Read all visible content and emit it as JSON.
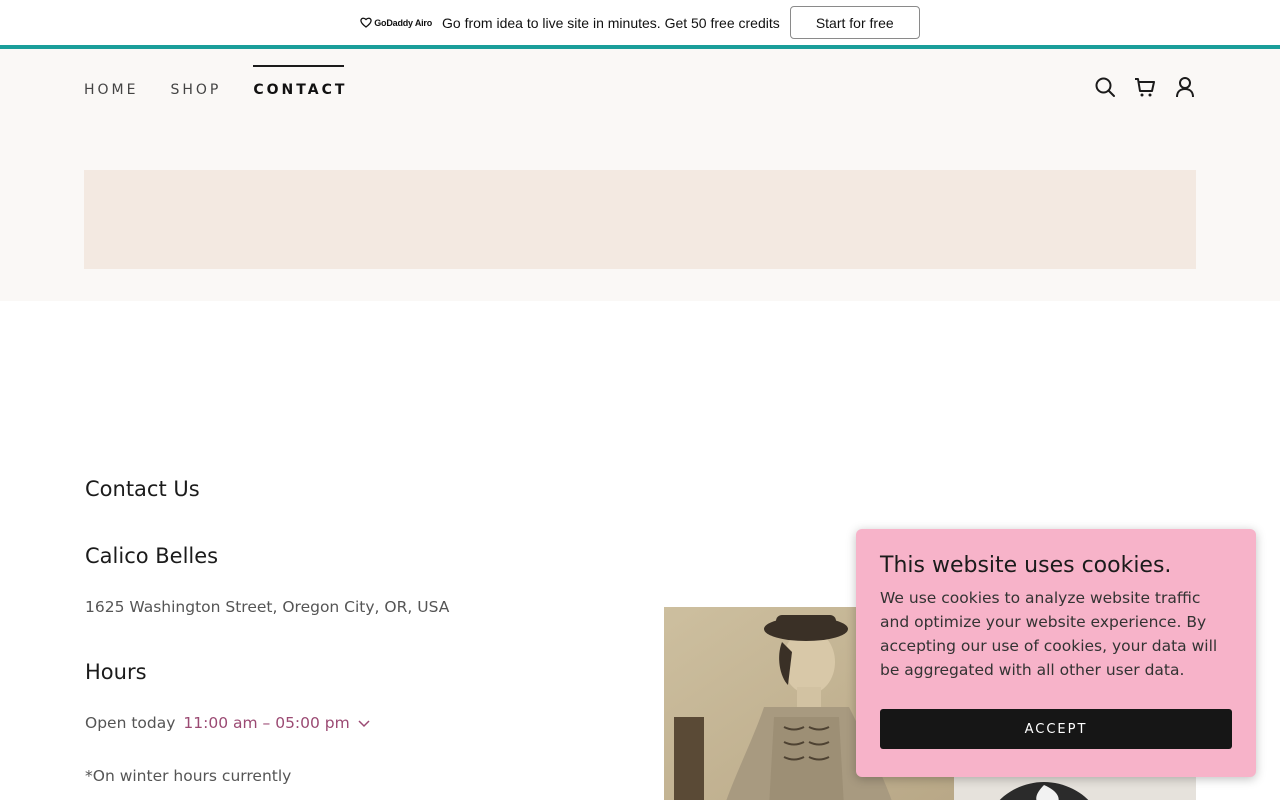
{
  "promo": {
    "logo_text": "GoDaddy Airo",
    "message": "Go from idea to live site in minutes. Get 50 free credits",
    "cta_label": "Start for free",
    "accent_color": "#1a9e9a"
  },
  "nav": {
    "items": [
      {
        "label": "HOME",
        "active": false
      },
      {
        "label": "SHOP",
        "active": false
      },
      {
        "label": "CONTACT",
        "active": true
      }
    ],
    "icons": [
      "search-icon",
      "cart-icon",
      "account-icon"
    ]
  },
  "contact": {
    "heading": "Contact Us",
    "business_name": "Calico Belles",
    "address": "1625 Washington Street, Oregon City, OR, USA",
    "hours_heading": "Hours",
    "open_label": "Open today",
    "hours_value": "11:00 am – 05:00 pm",
    "note": "*On winter hours currently"
  },
  "cookie_banner": {
    "title": "This website uses cookies.",
    "body": "We use cookies to analyze website traffic and optimize your website experience. By accepting our use of cookies, your data will be aggregated with all other user data.",
    "accept_label": "ACCEPT",
    "background_color": "#f7b3c9"
  }
}
